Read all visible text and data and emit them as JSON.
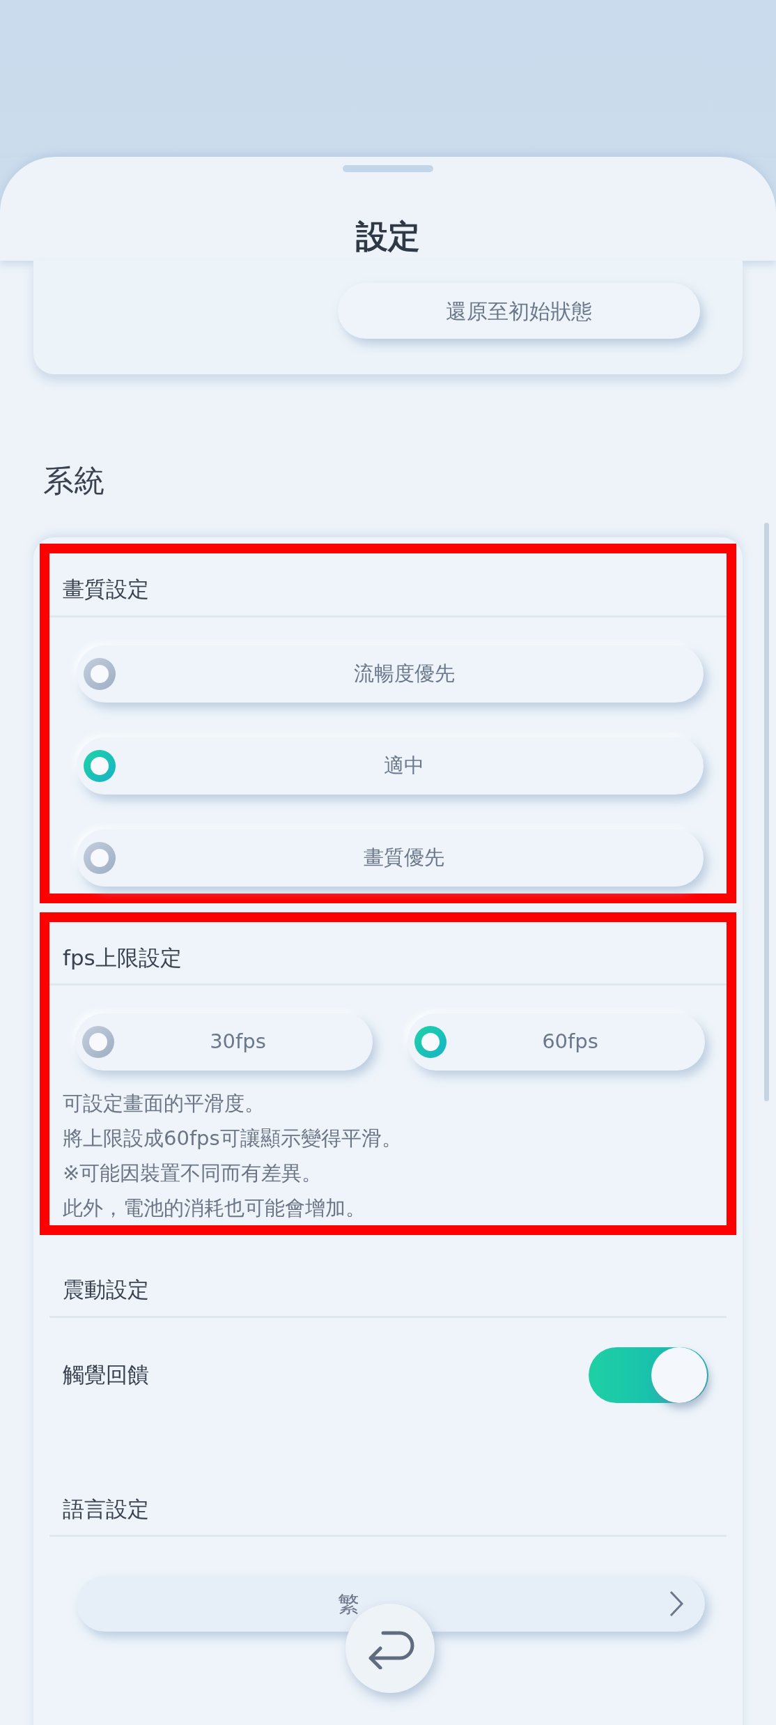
{
  "sheet": {
    "title": "設定"
  },
  "reset_card": {
    "button": "還原至初始狀態"
  },
  "section_title": "系統",
  "groups": [
    {
      "kind": "radio_list",
      "title": "畫質設定",
      "highlighted": true,
      "options": [
        {
          "label": "流暢度優先",
          "selected": false
        },
        {
          "label": "適中",
          "selected": true
        },
        {
          "label": "畫質優先",
          "selected": false
        }
      ]
    },
    {
      "kind": "radio_row",
      "title": "fps上限設定",
      "highlighted": true,
      "options": [
        {
          "label": "30fps",
          "selected": false
        },
        {
          "label": "60fps",
          "selected": true
        }
      ],
      "notes": [
        "可設定畫面的平滑度。",
        "將上限設成60fps可讓顯示變得平滑。",
        "※可能因裝置不同而有差異。",
        "此外，電池的消耗也可能會增加。"
      ]
    },
    {
      "kind": "toggle",
      "title": "震動設定",
      "highlighted": false,
      "label": "觸覺回饋",
      "on": true
    },
    {
      "kind": "select",
      "title": "語言設定",
      "highlighted": false,
      "value": "繁"
    }
  ]
}
